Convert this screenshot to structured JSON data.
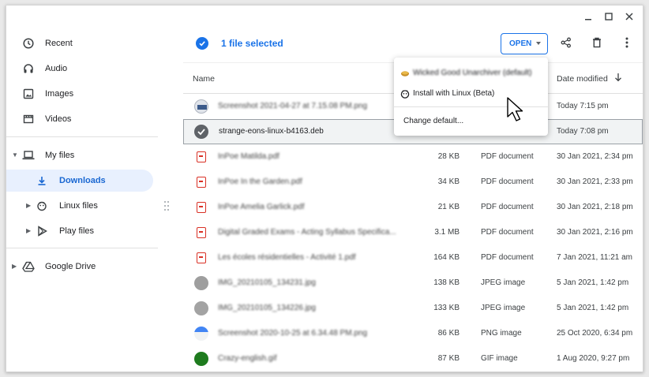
{
  "sidebar": {
    "items": [
      {
        "label": "Recent",
        "icon": "clock-icon"
      },
      {
        "label": "Audio",
        "icon": "headphones-icon"
      },
      {
        "label": "Images",
        "icon": "image-icon"
      },
      {
        "label": "Videos",
        "icon": "film-icon"
      },
      {
        "label": "My files",
        "icon": "laptop-icon"
      },
      {
        "label": "Downloads",
        "icon": "download-icon"
      },
      {
        "label": "Linux files",
        "icon": "linux-penguin-icon"
      },
      {
        "label": "Play files",
        "icon": "play-store-icon"
      },
      {
        "label": "Google Drive",
        "icon": "google-drive-icon"
      }
    ]
  },
  "header": {
    "selection_text": "1 file selected",
    "open_label": "OPEN"
  },
  "columns": {
    "name": "Name",
    "date": "Date modified"
  },
  "files": [
    {
      "name": "Screenshot 2021-04-27 at 7.15.08 PM.png",
      "size": "",
      "type": "",
      "date": "Today 7:15 pm",
      "icon": "png"
    },
    {
      "name": "strange-eons-linux-b4163.deb",
      "size": "",
      "type": "",
      "date": "Today 7:08 pm",
      "icon": "deb"
    },
    {
      "name": "InPoe Matilda.pdf",
      "size": "28 KB",
      "type": "PDF document",
      "date": "30 Jan 2021, 2:34 pm",
      "icon": "pdf"
    },
    {
      "name": "InPoe In the Garden.pdf",
      "size": "34 KB",
      "type": "PDF document",
      "date": "30 Jan 2021, 2:33 pm",
      "icon": "pdf"
    },
    {
      "name": "InPoe Amelia Garlick.pdf",
      "size": "21 KB",
      "type": "PDF document",
      "date": "30 Jan 2021, 2:18 pm",
      "icon": "pdf"
    },
    {
      "name": "Digital Graded Exams - Acting Syllabus Specifica...",
      "size": "3.1 MB",
      "type": "PDF document",
      "date": "30 Jan 2021, 2:16 pm",
      "icon": "pdf"
    },
    {
      "name": "Les écoles résidentielles - Activité 1.pdf",
      "size": "164 KB",
      "type": "PDF document",
      "date": "7 Jan 2021, 11:21 am",
      "icon": "pdf"
    },
    {
      "name": "IMG_20210105_134231.jpg",
      "size": "138 KB",
      "type": "JPEG image",
      "date": "5 Jan 2021, 1:42 pm",
      "icon": "jpg"
    },
    {
      "name": "IMG_20210105_134226.jpg",
      "size": "133 KB",
      "type": "JPEG image",
      "date": "5 Jan 2021, 1:42 pm",
      "icon": "jpg"
    },
    {
      "name": "Screenshot 2020-10-25 at 6.34.48 PM.png",
      "size": "86 KB",
      "type": "PNG image",
      "date": "25 Oct 2020, 6:34 pm",
      "icon": "png2"
    },
    {
      "name": "Crazy-english.gif",
      "size": "87 KB",
      "type": "GIF image",
      "date": "1 Aug 2020, 9:27 pm",
      "icon": "gif"
    }
  ],
  "menu": {
    "default_app": "Wicked Good Unarchiver (default)",
    "install_linux": "Install with Linux (Beta)",
    "change_default": "Change default..."
  },
  "colors": {
    "accent": "#1a73e8",
    "active_bg": "#e8f0fe",
    "pdf_red": "#d93025"
  }
}
